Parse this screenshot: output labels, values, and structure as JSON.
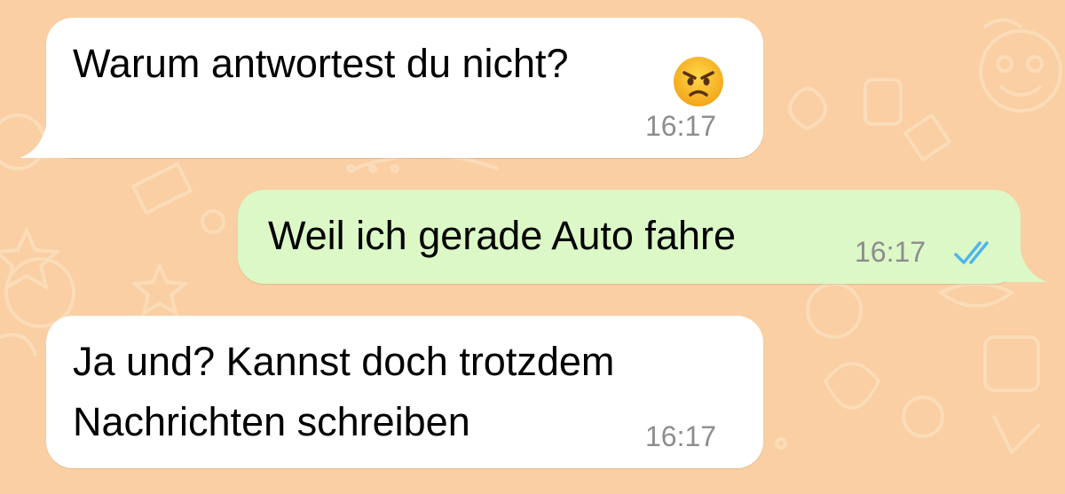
{
  "chat": {
    "messages": [
      {
        "direction": "incoming",
        "text": "Warum antwortest du nicht?",
        "emoji": "angry-face-emoji",
        "time": "16:17"
      },
      {
        "direction": "outgoing",
        "text": "Weil ich gerade Auto fahre",
        "time": "16:17",
        "status": "read-double-check"
      },
      {
        "direction": "incoming",
        "lines": [
          "Ja und? Kannst doch trotzdem",
          "Nachrichten schreiben"
        ],
        "time": "16:17"
      }
    ]
  },
  "colors": {
    "background": "#f9cfa3",
    "incoming_bubble": "#ffffff",
    "outgoing_bubble": "#dcf8c6",
    "timestamp": "#8d8d8d",
    "read_ticks": "#4fb6ec"
  }
}
